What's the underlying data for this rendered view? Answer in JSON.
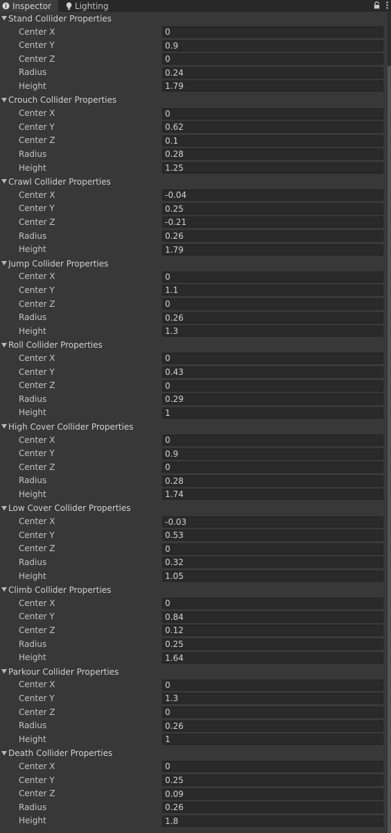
{
  "tabs": {
    "inspector_label": "Inspector",
    "inspector_icon": "info-icon",
    "lighting_label": "Lighting",
    "lighting_icon": "lightbulb-icon",
    "lock_icon": "lock-icon",
    "menu_icon": "kebab-menu-icon"
  },
  "colors": {
    "background": "#383838",
    "tab_bar": "#282828",
    "field": "#2a2a2a",
    "text": "#c4c4c4"
  },
  "field_labels": {
    "center_x": "Center X",
    "center_y": "Center Y",
    "center_z": "Center Z",
    "radius": "Radius",
    "height": "Height"
  },
  "sections": [
    {
      "title": "Stand Collider Properties",
      "center_x": "0",
      "center_y": "0.9",
      "center_z": "0",
      "radius": "0.24",
      "height": "1.79"
    },
    {
      "title": "Crouch Collider Properties",
      "center_x": "0",
      "center_y": "0.62",
      "center_z": "0.1",
      "radius": "0.28",
      "height": "1.25"
    },
    {
      "title": "Crawl Collider Properties",
      "center_x": "-0.04",
      "center_y": "0.25",
      "center_z": "-0.21",
      "radius": "0.26",
      "height": "1.79"
    },
    {
      "title": "Jump Collider Properties",
      "center_x": "0",
      "center_y": "1.1",
      "center_z": "0",
      "radius": "0.26",
      "height": "1.3"
    },
    {
      "title": "Roll Collider Properties",
      "center_x": "0",
      "center_y": "0.43",
      "center_z": "0",
      "radius": "0.29",
      "height": "1"
    },
    {
      "title": "High Cover Collider Properties",
      "center_x": "0",
      "center_y": "0.9",
      "center_z": "0",
      "radius": "0.28",
      "height": "1.74"
    },
    {
      "title": "Low Cover Collider Properties",
      "center_x": "-0.03",
      "center_y": "0.53",
      "center_z": "0",
      "radius": "0.32",
      "height": "1.05"
    },
    {
      "title": "Climb Collider Properties",
      "center_x": "0",
      "center_y": "0.84",
      "center_z": "0.12",
      "radius": "0.25",
      "height": "1.64"
    },
    {
      "title": "Parkour Collider Properties",
      "center_x": "0",
      "center_y": "1.3",
      "center_z": "0",
      "radius": "0.26",
      "height": "1"
    },
    {
      "title": "Death Collider Properties",
      "center_x": "0",
      "center_y": "0.25",
      "center_z": "0.09",
      "radius": "0.26",
      "height": "1.8"
    }
  ]
}
